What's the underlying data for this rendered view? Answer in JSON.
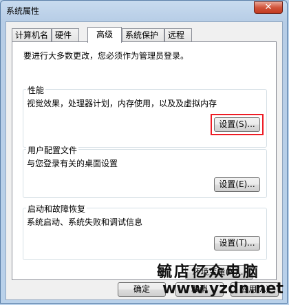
{
  "window": {
    "title": "系统属性",
    "close_symbol": "✕"
  },
  "tabs": [
    {
      "label": "计算机名"
    },
    {
      "label": "硬件"
    },
    {
      "label": "高级"
    },
    {
      "label": "系统保护"
    },
    {
      "label": "远程"
    }
  ],
  "intro_text": "要进行大多数更改，您必须作为管理员登录。",
  "performance": {
    "title": "性能",
    "description": "视觉效果，处理器计划，内存使用，以及及虚拟内存",
    "button": "设置(S)..."
  },
  "user_profiles": {
    "title": "用户配置文件",
    "description": "与您登录有关的桌面设置",
    "button": "设置(E)..."
  },
  "startup_recovery": {
    "title": "启动和故障恢复",
    "description": "系统启动、系统失败和调试信息",
    "button": "设置(T)..."
  },
  "env_button": "环境变量(N)...",
  "footer": {
    "ok": "确定",
    "cancel": "取消",
    "apply": "应用(A)"
  },
  "watermark": {
    "name": "毓店亿众电脑",
    "url": "www.yzdn.net"
  }
}
